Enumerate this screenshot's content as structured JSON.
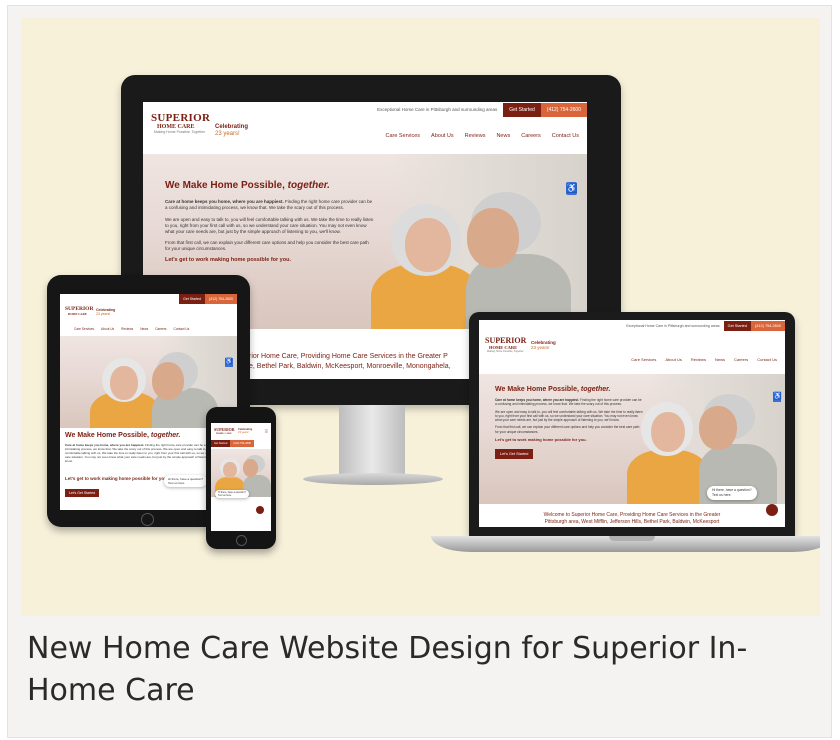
{
  "caption": "New Home Care Website Design for Superior In-Home Care",
  "site": {
    "tagline": "Exceptional Home Care in Pittsburgh and surrounding areas",
    "get_started": "Get Started",
    "phone": "(412) 754-2600",
    "logo_line1": "SUPERIOR",
    "logo_line2": "HOME CARE",
    "logo_line3": "Making Home Possible, Together",
    "celebrating": "Celebrating",
    "years": "23 years!",
    "nav": [
      "Care Services",
      "About Us",
      "Reviews",
      "News",
      "Careers",
      "Contact Us"
    ],
    "headline_main": "We Make Home Possible, ",
    "headline_em": "together.",
    "para1_bold": "Care at home keeps you home, where you are happiest.",
    "para1_rest": " Finding the right home care provider can be a confusing and intimidating process, we know that. We take the scary out of this process.",
    "para2": "We are open and easy to talk to, you will feel comfortable talking with us. We take the time to really listen to you, right from your first call with us, so we understand your care situation. You may not even know what your care needs are, but just by the simple approach of listening to you, we'll know.",
    "para3": "From that first call, we can explain your different care options and help you consider the best care path for your unique circumstances.",
    "cta_line": "Let's get to work making home possible for you.",
    "cta_button": "Let's Get Started",
    "welcome_monitor_1": "rior Home Care, Providing Home Care Services in the Greater P",
    "welcome_monitor_2": "e, Bethel Park, Baldwin, McKeesport, Monroeville, Monongahela,",
    "welcome_laptop_1": "Welcome to Superior Home Care, Providing Home Care Services in the Greater",
    "welcome_laptop_2": "Pittsburgh area, West Mifflin, Jefferson Hills, Bethel Park, Baldwin, McKeesport",
    "chat_1": "Hi there, have a question?",
    "chat_2": "Text us here."
  },
  "colors": {
    "brand": "#7a1f12",
    "accent": "#d9663b",
    "hero_bg": "#f7f1da"
  },
  "icons": [
    "accessibility-icon",
    "chat-icon",
    "hamburger-menu-icon"
  ]
}
